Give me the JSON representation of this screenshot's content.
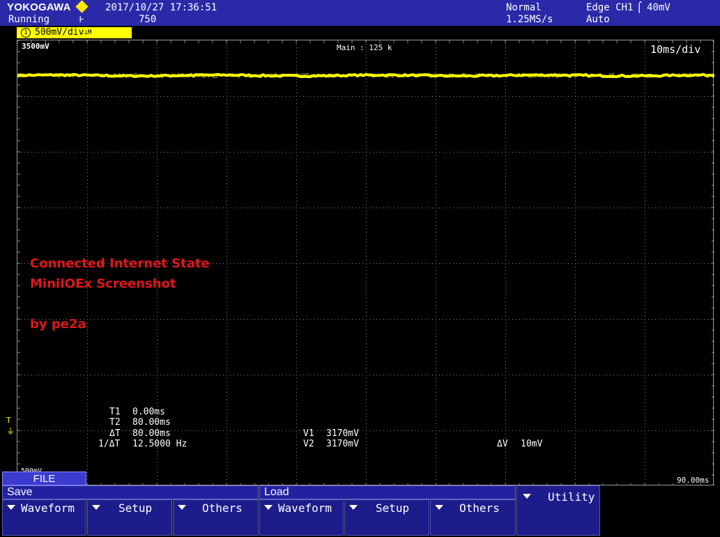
{
  "header": {
    "brand": "YOKOGAWA",
    "status": "Running",
    "datetime": "2017/10/27  17:36:51",
    "record_count": "750",
    "trigger_mode": "Normal",
    "sample_rate": "1.25MS/s",
    "trigger_source": "Edge CH1",
    "trigger_level": "40mV",
    "acq_mode": "Auto"
  },
  "channel": {
    "number": "1",
    "scale": "500mV/div"
  },
  "screen": {
    "top_level": "3500mV",
    "main_label": "Main : 125 k",
    "time_div": "10ms/div",
    "bottom_level": "500mV",
    "end_time": "90.00ms",
    "trace_color": "#ffff00",
    "grid_color": "#8c8c8c"
  },
  "annotation": {
    "line1": "Connected Internet State",
    "line2": "MiniIOEx Screenshot",
    "line3": "by pe2a",
    "color": "#e0161a"
  },
  "cursors": {
    "t1_label": "T1",
    "t1_value": "0.00ms",
    "t2_label": "T2",
    "t2_value": "80.00ms",
    "dt_label": "ΔT",
    "dt_value": "80.00ms",
    "inv_dt_label": "1/ΔT",
    "inv_dt_value": "12.5000 Hz",
    "v1_label": "V1",
    "v1_value": "3170mV",
    "v2_label": "V2",
    "v2_value": "3170mV",
    "dv_label": "ΔV",
    "dv_value": "10mV"
  },
  "menu": {
    "file_tab": "FILE",
    "save_group": "Save",
    "load_group": "Load",
    "save_waveform": "Waveform",
    "save_setup": "Setup",
    "save_others": "Others",
    "load_waveform": "Waveform",
    "load_setup": "Setup",
    "load_others": "Others",
    "utility": "Utility"
  }
}
